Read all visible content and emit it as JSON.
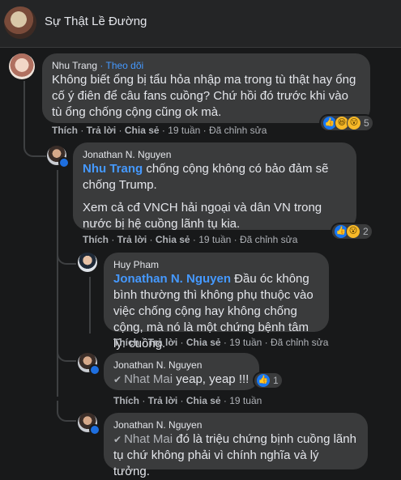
{
  "header": {
    "title": "Sự Thật Lề Đường"
  },
  "comments": [
    {
      "author": "Nhu Trang",
      "follow": " · Theo dõi",
      "text": "Không biết ổng bị tẩu hỏa nhập ma trong tù thật hay ổng cố ý điên để câu fans cuồng? Chứ hồi đó trước khi vào tù ổng chống cộng cũng ok mà.",
      "actions": {
        "like": "Thích",
        "reply": "Trả lời",
        "share": "Chia sẻ",
        "time": "19 tuần",
        "edited": "Đã chỉnh sửa"
      },
      "reaction_count": "5"
    },
    {
      "author": "Jonathan N. Nguyen",
      "mention": "Nhu Trang",
      "text1": " chống cộng không có bảo đảm sẽ chống Trump.",
      "text2": "Xem cả cđ VNCH hải ngoại và dân VN trong nước bị hệ cuồng lãnh tụ kia.",
      "actions": {
        "like": "Thích",
        "reply": "Trả lời",
        "share": "Chia sẻ",
        "time": "19 tuần",
        "edited": "Đã chỉnh sửa"
      },
      "reaction_count": "2"
    },
    {
      "author": "Huy Pham",
      "mention": "Jonathan N. Nguyen",
      "text": " Đầu óc không bình thường thì không phụ thuộc vào việc chống cộng hay không chống cộng, mà nó là một chứng bệnh tâm lý: cuồng.",
      "actions": {
        "like": "Thích",
        "reply": "Trả lời",
        "share": "Chia sẻ",
        "time": "19 tuần",
        "edited": "Đã chỉnh sửa"
      }
    },
    {
      "author": "Jonathan N. Nguyen",
      "mention": "Nhat Mai",
      "text": " yeap, yeap !!!",
      "actions": {
        "like": "Thích",
        "reply": "Trả lời",
        "share": "Chia sẻ",
        "time": "19 tuần"
      },
      "reaction_count": "1"
    },
    {
      "author": "Jonathan N. Nguyen",
      "mention": "Nhat Mai",
      "text": " đó là triệu chứng bịnh cuồng lãnh tụ chứ không phải vì chính nghĩa và lý tưởng."
    }
  ]
}
